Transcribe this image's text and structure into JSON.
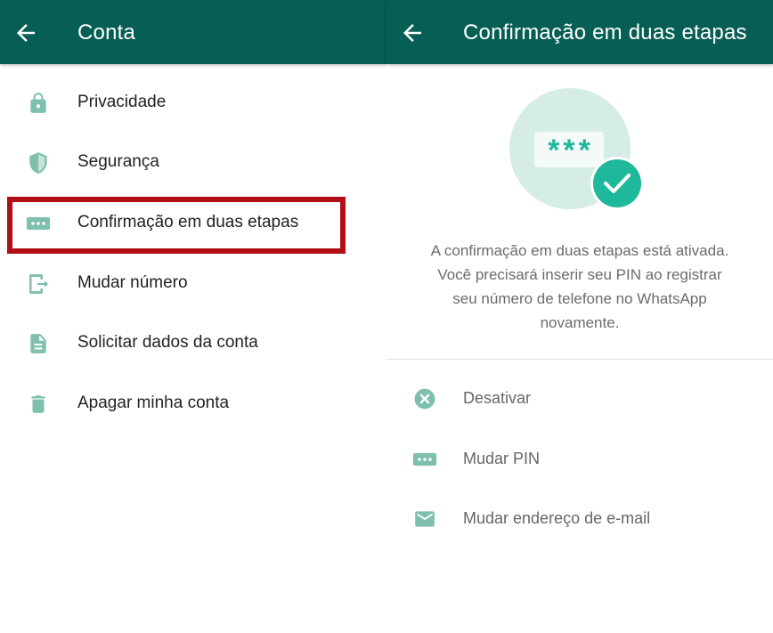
{
  "left": {
    "title": "Conta",
    "items": [
      {
        "label": "Privacidade",
        "icon": "lock-icon"
      },
      {
        "label": "Segurança",
        "icon": "shield-icon"
      },
      {
        "label": "Confirmação em duas etapas",
        "icon": "dots-keypad-icon"
      },
      {
        "label": "Mudar número",
        "icon": "phone-transfer-icon"
      },
      {
        "label": "Solicitar dados da conta",
        "icon": "document-icon"
      },
      {
        "label": "Apagar minha conta",
        "icon": "trash-icon"
      }
    ]
  },
  "right": {
    "title": "Confirmação em duas etapas",
    "illustration": {
      "pin_mask": "***"
    },
    "description": [
      "A confirmação em duas etapas está ativada.",
      "Você precisará inserir seu PIN ao registrar",
      "seu número de telefone no WhatsApp",
      "novamente."
    ],
    "options": [
      {
        "label": "Desativar",
        "icon": "close-circle-icon"
      },
      {
        "label": "Mudar PIN",
        "icon": "dots-keypad-icon"
      },
      {
        "label": "Mudar endereço de e-mail",
        "icon": "mail-icon"
      }
    ]
  },
  "colors": {
    "appbar": "#075e54",
    "icon": "#7fbfae",
    "accent": "#20b89a",
    "highlight_border": "#b30d17"
  }
}
